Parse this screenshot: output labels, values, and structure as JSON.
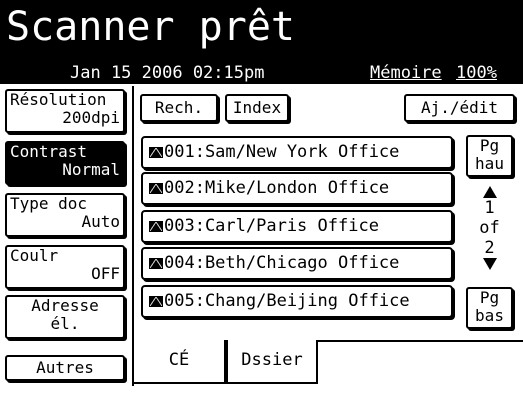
{
  "header": {
    "title": "Scanner prêt",
    "date": "Jan 15 2006 02:15pm",
    "memory_label": "Mémoire",
    "memory_value": "100%"
  },
  "left_menu": {
    "resolution": {
      "label": "Résolution",
      "value": "200dpi"
    },
    "contrast": {
      "label": "Contrast",
      "value": "Normal"
    },
    "doc_type": {
      "label": "Type doc",
      "value": "Auto"
    },
    "color": {
      "label": "Coulr",
      "value": "OFF"
    },
    "address": {
      "label": "Adresse",
      "value": "él."
    },
    "others": {
      "label": "Autres"
    }
  },
  "toolbar": {
    "search": "Rech.",
    "index": "Index",
    "add_edit": "Aj./édit"
  },
  "entries": [
    "001:Sam/New York Office",
    "002:Mike/London Office",
    "003:Carl/Paris Office",
    "004:Beth/Chicago Office",
    "005:Chang/Beijing Office"
  ],
  "pager": {
    "up_line1": "Pg",
    "up_line2": "hau",
    "current": "1",
    "of": "of",
    "total": "2",
    "down_line1": "Pg",
    "down_line2": "bas"
  },
  "tabs": {
    "ce": "CÉ",
    "folder": "Dssier"
  }
}
